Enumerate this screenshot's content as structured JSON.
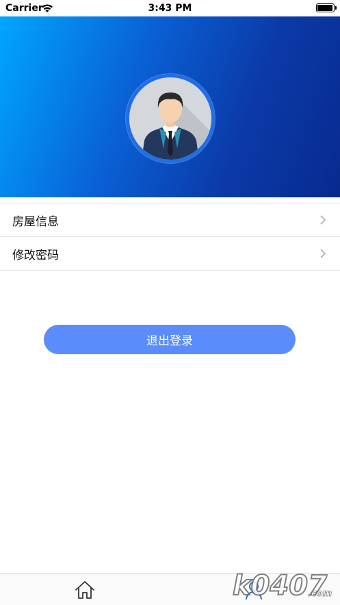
{
  "status_bar": {
    "carrier": "Carrier",
    "time": "3:43 PM",
    "battery_level": 0.95
  },
  "header": {
    "avatar_icon": "businessman-avatar-icon",
    "gradient_colors": [
      "#00a6ff",
      "#082a8e"
    ]
  },
  "menu": {
    "items": [
      {
        "label": "房屋信息",
        "icon": "chevron-right-icon"
      },
      {
        "label": "修改密码",
        "icon": "chevron-right-icon"
      }
    ]
  },
  "logout": {
    "label": "退出登录",
    "color": "#5b8cfb"
  },
  "tab_bar": {
    "tabs": [
      {
        "icon": "home-icon"
      },
      {
        "icon": "profile-icon",
        "active": true
      }
    ]
  },
  "watermark": {
    "text": "k0407.com"
  }
}
